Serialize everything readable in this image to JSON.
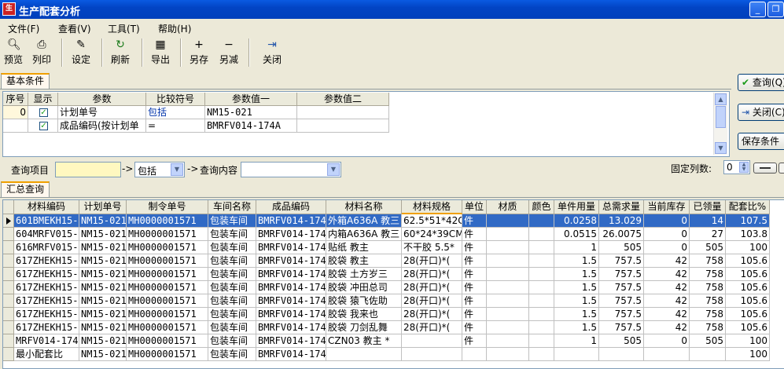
{
  "window": {
    "title": "生产配套分析",
    "icon_label": "生",
    "min_glyph": "_",
    "restore_glyph": "❐"
  },
  "menu": [
    "文件(F)",
    "查看(V)",
    "工具(T)",
    "帮助(H)"
  ],
  "toolbar": {
    "preview": "预览",
    "print": "列印",
    "settings": "设定",
    "refresh": "刷新",
    "export": "导出",
    "save_as": "另存",
    "save_minus": "另减",
    "close": "关闭"
  },
  "tabs": {
    "basic_conditions": "基本条件",
    "summary_query": "汇总查询"
  },
  "conditions": {
    "columns": [
      "序号",
      "显示",
      "参数",
      "比较符号",
      "参数值一",
      "参数值二"
    ],
    "rows": [
      {
        "no": "0",
        "checked": true,
        "param": "计划单号",
        "op": "包括",
        "value1": "NM15-021",
        "value2": ""
      },
      {
        "no": "",
        "checked": true,
        "param": "成品编码(按计划单",
        "op": "=",
        "value1": "BMRFV014-174A",
        "value2": ""
      }
    ]
  },
  "side_buttons": {
    "query": "查询(Q)",
    "close": "关闭(C)",
    "save_conditions": "保存条件"
  },
  "query_bar": {
    "item_label": "查询项目",
    "arrow1": "->",
    "op_value": "包括",
    "arrow2": "->",
    "content_label": "查询内容",
    "fixed_cols_label": "固定列数:",
    "fixed_cols_value": "0"
  },
  "table": {
    "columns": [
      "材料编码",
      "计划单号",
      "制令单号",
      "车间名称",
      "成品编码",
      "材料名称",
      "材料规格",
      "单位",
      "材质",
      "颜色",
      "单件用量",
      "总需求量",
      "当前库存",
      "已领量",
      "配套比%"
    ],
    "rows": [
      [
        "601BMEKH15-",
        "NM15-021",
        "MH0000001571",
        "包装车间",
        "BMRFV014-174.",
        "外箱A636A  教三",
        "62.5*51*42C",
        "件",
        "",
        "",
        "0.0258",
        "13.029",
        "0",
        "14",
        "107.5"
      ],
      [
        "604MRFV015-",
        "NM15-021",
        "MH0000001571",
        "包装车间",
        "BMRFV014-174.",
        "内箱A636A  教三",
        "60*24*39CM",
        "件",
        "",
        "",
        "0.0515",
        "26.0075",
        "0",
        "27",
        "103.8"
      ],
      [
        "616MRFV015-",
        "NM15-021",
        "MH0000001571",
        "包装车间",
        "BMRFV014-174.",
        "贴纸 教主",
        "不干胶 5.5*",
        "件",
        "",
        "",
        "1",
        "505",
        "0",
        "505",
        "100"
      ],
      [
        "617ZHEKH15-",
        "NM15-021",
        "MH0000001571",
        "包装车间",
        "BMRFV014-174.",
        "胶袋 教主",
        "28(开口)*(",
        "件",
        "",
        "",
        "1.5",
        "757.5",
        "42",
        "758",
        "105.6"
      ],
      [
        "617ZHEKH15-",
        "NM15-021",
        "MH0000001571",
        "包装车间",
        "BMRFV014-174.",
        "胶袋 土方岁三",
        "28(开口)*(",
        "件",
        "",
        "",
        "1.5",
        "757.5",
        "42",
        "758",
        "105.6"
      ],
      [
        "617ZHEKH15-",
        "NM15-021",
        "MH0000001571",
        "包装车间",
        "BMRFV014-174.",
        "胶袋 冲田总司",
        "28(开口)*(",
        "件",
        "",
        "",
        "1.5",
        "757.5",
        "42",
        "758",
        "105.6"
      ],
      [
        "617ZHEKH15-",
        "NM15-021",
        "MH0000001571",
        "包装车间",
        "BMRFV014-174.",
        "胶袋   猿飞佐助",
        "28(开口)*(",
        "件",
        "",
        "",
        "1.5",
        "757.5",
        "42",
        "758",
        "105.6"
      ],
      [
        "617ZHEKH15-",
        "NM15-021",
        "MH0000001571",
        "包装车间",
        "BMRFV014-174.",
        "胶袋    我来也",
        "28(开口)*(",
        "件",
        "",
        "",
        "1.5",
        "757.5",
        "42",
        "758",
        "105.6"
      ],
      [
        "617ZHEKH15-",
        "NM15-021",
        "MH0000001571",
        "包装车间",
        "BMRFV014-174.",
        "胶袋    刀剑乱舞",
        "28(开口)*(",
        "件",
        "",
        "",
        "1.5",
        "757.5",
        "42",
        "758",
        "105.6"
      ],
      [
        "MRFV014-174-",
        "NM15-021",
        "MH0000001571",
        "包装车间",
        "BMRFV014-174.",
        "CZN03 教主 *",
        "",
        "件",
        "",
        "",
        "1",
        "505",
        "0",
        "505",
        "100"
      ],
      [
        "最小配套比",
        "NM15-021",
        "MH0000001571",
        "包装车间",
        "BMRFV014-174.",
        "",
        "",
        "",
        "",
        "",
        "",
        "",
        "",
        "",
        "100"
      ]
    ]
  },
  "colors": {
    "title_bar": "#0054e3",
    "selection": "#316ac5",
    "tab_accent": "#f0a000"
  }
}
